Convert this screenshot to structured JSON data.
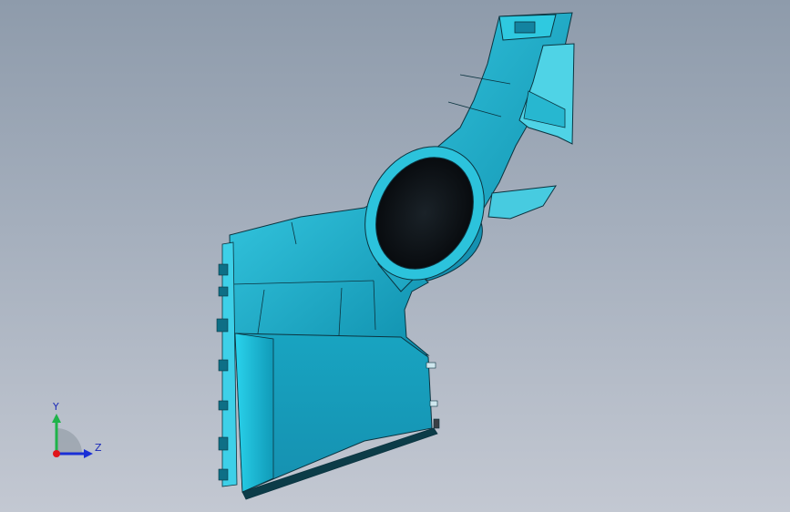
{
  "viewport": {
    "background_top": "#8e9bab",
    "background_bottom": "#c3c8d2"
  },
  "model": {
    "surface_color": "#1aa6c0",
    "surface_light": "#2ec4de",
    "edge_color": "#0b2f3a",
    "opening_color": "#0a0d12"
  },
  "triad": {
    "y_label": "Y",
    "z_label": "Z",
    "y_color": "#1fb34a",
    "z_color": "#1a2fd6",
    "x_color": "#e0141a"
  }
}
